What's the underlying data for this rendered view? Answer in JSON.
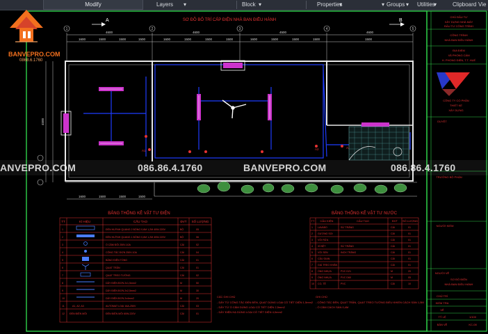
{
  "ribbon": {
    "modify": "Modify",
    "layers": "Layers",
    "block": "Block",
    "properties": "Properties",
    "groups": "Groups",
    "utilities": "Utilities",
    "clipboard": "Clipboard",
    "view": "Vie"
  },
  "logo": {
    "brand": "BANVEPRO.COM",
    "phone": "0868.6.1760"
  },
  "watermark": {
    "left": "ANVEPRO.COM",
    "phone1": "086.86.4.1760",
    "center": "BANVEPRO.COM",
    "phone2": "086.86.4.1760"
  },
  "plan": {
    "title": "SƠ ĐỒ BỐ TRÍ CẤP ĐIỆN NHÀ BAN ĐIỀU HÀNH",
    "section_left": "A",
    "section_right": "B",
    "grid_axes": [
      "1",
      "2",
      "3",
      "4",
      "5"
    ],
    "dims_top": [
      "4600",
      "4600",
      "4500",
      "4600"
    ],
    "dims_sub": [
      "1600",
      "1500",
      "1500",
      "1500",
      "1600",
      "1500",
      "1500",
      "1500",
      "1600",
      "1500",
      "1500",
      "1500",
      "1500"
    ],
    "dims_bottom": [
      "1600",
      "1500",
      "1500",
      "1500"
    ],
    "dim_left": "4500",
    "labels_a": [
      "A1",
      "A2",
      "A3"
    ]
  },
  "table_left": {
    "title": "BẢNG THỐNG KÊ VẬT TƯ ĐIỆN",
    "headers": [
      "TT",
      "KÍ HIỆU",
      "CẤU TẠO",
      "ĐVT",
      "SỐ LƯỢNG"
    ],
    "rows": [
      {
        "tt": "1",
        "sym": "",
        "desc": "ĐÈN HUỲNH QUANG 2 BÓNG 0,6M 1,2M 40W-220V",
        "unit": "BỘ",
        "qty": "05"
      },
      {
        "tt": "2",
        "sym": "",
        "desc": "ĐÈN HUỲNH QUANG 1 BÓNG 0,6M 1,2M 40W-220V",
        "unit": "BỘ",
        "qty": "06"
      },
      {
        "tt": "3",
        "sym": "",
        "desc": "Ổ CẮM ĐÔI 250V-10A",
        "unit": "CÁI",
        "qty": "02"
      },
      {
        "tt": "4",
        "sym": "",
        "desc": "CÔNG TẮC ĐƠN 250V-10A",
        "unit": "CÁI",
        "qty": "04"
      },
      {
        "tt": "5",
        "sym": "",
        "desc": "BẢNG ĐIỆN TỔNG",
        "unit": "CÁI",
        "qty": "01"
      },
      {
        "tt": "6",
        "sym": "",
        "desc": "QUẠT TRẦN",
        "unit": "CÁI",
        "qty": "01"
      },
      {
        "tt": "7",
        "sym": "",
        "desc": "QUẠT TREO TƯỜNG",
        "unit": "CÁI",
        "qty": "02"
      },
      {
        "tt": "8",
        "sym": "",
        "desc": "DÂY ĐIỆN ĐƠN 2x1,5mm2",
        "unit": "M",
        "qty": "50"
      },
      {
        "tt": "9",
        "sym": "",
        "desc": "DÂY ĐIỆN ĐƠN 2x2,5mm2",
        "unit": "M",
        "qty": "30"
      },
      {
        "tt": "10",
        "sym": "",
        "desc": "DÂY ĐIỆN ĐƠN 2x4mm2",
        "unit": "M",
        "qty": "20"
      },
      {
        "tt": "11",
        "sym": "A1, A2, A3",
        "desc": "AUTOMAT LOẠI 16A-250V",
        "unit": "CÁI",
        "qty": "03"
      },
      {
        "tt": "12",
        "sym": "ĐÈN ĐIỆN MÔI",
        "desc": "ĐÈN ĐIỆN MÔI 60W-220V",
        "unit": "CÁI",
        "qty": "01"
      }
    ]
  },
  "table_right": {
    "title": "BẢNG THỐNG KÊ VẬT TƯ NƯỚC",
    "headers": [
      "TT",
      "CẤU KIỆN",
      "CẤU TẠO",
      "ĐVT",
      "SỐ LƯỢNG"
    ],
    "rows": [
      {
        "tt": "1",
        "item": "LAVABO",
        "desc": "SỨ TRẮNG",
        "unit": "CÁI",
        "qty": "01"
      },
      {
        "tt": "2",
        "item": "GƯƠNG SOI",
        "desc": "",
        "unit": "CÁI",
        "qty": "01"
      },
      {
        "tt": "3",
        "item": "VÒI RỬA",
        "desc": "",
        "unit": "CÁI",
        "qty": "01"
      },
      {
        "tt": "4",
        "item": "XÍ BỆT",
        "desc": "SỨ TRẮNG",
        "unit": "CÁI",
        "qty": "01"
      },
      {
        "tt": "5",
        "item": "VÒI SEN",
        "desc": "INOX TRẮNG",
        "unit": "CÁI",
        "qty": "01"
      },
      {
        "tt": "6",
        "item": "CẦU GIAN",
        "desc": "",
        "unit": "CÁI",
        "qty": "01"
      },
      {
        "tt": "7",
        "item": "GIÁ TREO KHĂN",
        "desc": "",
        "unit": "CÁI",
        "qty": "01"
      },
      {
        "tt": "8",
        "item": "ỐNG NHỰA",
        "desc": "PVC D21",
        "unit": "M",
        "qty": "20"
      },
      {
        "tt": "9",
        "item": "ỐNG NHỰA",
        "desc": "PVC D60",
        "unit": "M",
        "qty": "05"
      },
      {
        "tt": "10",
        "item": "CO, TÊ",
        "desc": "PVC",
        "unit": "CÁI",
        "qty": "10"
      }
    ]
  },
  "notes_left": {
    "title": "CÁC GHI CHÚ",
    "lines": [
      "- DÂY TỪ CÔNG TẮC ĐẾN ĐÈN, QUẠT DÙNG LOẠI CÓ TIẾT DIỆN 1,5mm2",
      "- DÂY TỪ Ổ CẮM DÙNG LOẠI CÓ TIẾT DIỆN 2,5mm2",
      "- DÂY ĐIỆN HẠ DÙNG LOẠI CÓ TIẾT DIỆN 4,0mm2"
    ]
  },
  "notes_right": {
    "title": "GHI CHÚ",
    "lines": [
      "- CÔNG TẮC ĐÈN, QUẠT TRẦN, QUẠT TREO TƯỜNG ĐIỀU KHIỂN CÁCH SÀN 1,5M",
      "- Ổ CẮM CÁCH SÀN 0,4M"
    ]
  },
  "titleblock": {
    "r1": [
      "CHỦ ĐẦU TƯ",
      "XÂY DỰNG NHÀ MÁY",
      "ĐẦU TƯ CÔNG TRÌNH"
    ],
    "r2": [
      "CÔNG TRÌNH",
      "NHÀ BAN ĐIỀU HÀNH"
    ],
    "r3": [
      "ĐỊA ĐIỂM",
      "XÃ PHONG CẨM",
      "H. PHONG ĐIỀN, T.T. HUẾ"
    ],
    "company": [
      "CÔNG TY CỔ PHẦN",
      "THIẾT KẾ",
      "XÂY DỰNG"
    ],
    "r4": "DUYỆT",
    "r5": "TRƯỞNG BỘ PHẬN",
    "r6": "NGƯỜI KIỂM",
    "r7": "NGƯỜI VẼ",
    "sheet_title": [
      "SƠ ĐỒ ĐIỆN",
      "NHÀ BAN ĐIỀU HÀNH"
    ],
    "bottom": [
      "CHỦ TRÌ",
      "KIỂM TRA",
      "VẼ",
      "TỶ LỆ",
      "1/100",
      "BẢN VẼ",
      "KC-08"
    ]
  }
}
